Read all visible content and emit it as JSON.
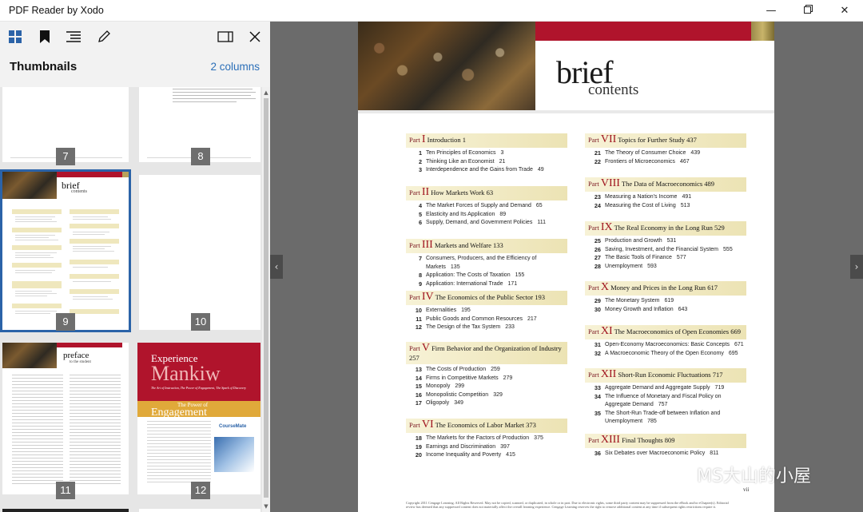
{
  "window": {
    "title": "PDF Reader by Xodo",
    "minimize": "—",
    "maximize": "❐",
    "close": "✕"
  },
  "panel": {
    "header_title": "Thumbnails",
    "columns_label": "2 columns",
    "tools": [
      "thumbnails-icon",
      "bookmark-icon",
      "outline-icon",
      "annotate-icon",
      "panel-layout-icon",
      "close-icon"
    ],
    "thumbnails": [
      {
        "page": "7"
      },
      {
        "page": "8"
      },
      {
        "page": "9",
        "title": "brief",
        "subtitle": "contents",
        "selected": true
      },
      {
        "page": "10"
      },
      {
        "page": "11",
        "title": "preface",
        "subtitle": "to the student"
      },
      {
        "page": "12",
        "title1": "Experience",
        "title2": "Mankiw",
        "tagline": "The Art of Instruction, The Power of Engagement, The Spark of Discovery",
        "title3": "The Power of",
        "title4": "Engagement",
        "brand": "CourseMate"
      }
    ]
  },
  "document": {
    "heading_big": "brief",
    "heading_small": "contents",
    "accent_red": "#b0142c",
    "parts_left": [
      {
        "word": "Part",
        "num": "I",
        "title": "Introduction",
        "page": "1",
        "chapters": [
          [
            "1",
            "Ten Principles of Economics",
            "3"
          ],
          [
            "2",
            "Thinking Like an Economist",
            "21"
          ],
          [
            "3",
            "Interdependence and the Gains from Trade",
            "49"
          ]
        ]
      },
      {
        "word": "Part",
        "num": "II",
        "title": "How Markets Work",
        "page": "63",
        "chapters": [
          [
            "4",
            "The Market Forces of Supply and Demand",
            "65"
          ],
          [
            "5",
            "Elasticity and Its Application",
            "89"
          ],
          [
            "6",
            "Supply, Demand, and Government Policies",
            "111"
          ]
        ]
      },
      {
        "word": "Part",
        "num": "III",
        "title": "Markets and Welfare",
        "page": "133",
        "chapters": [
          [
            "7",
            "Consumers, Producers, and the Efficiency of Markets",
            "135"
          ],
          [
            "8",
            "Application: The Costs of Taxation",
            "155"
          ],
          [
            "9",
            "Application: International Trade",
            "171"
          ]
        ]
      },
      {
        "word": "Part",
        "num": "IV",
        "title": "The Economics of the Public Sector",
        "page": "193",
        "chapters": [
          [
            "10",
            "Externalities",
            "195"
          ],
          [
            "11",
            "Public Goods and Common Resources",
            "217"
          ],
          [
            "12",
            "The Design of the Tax System",
            "233"
          ]
        ]
      },
      {
        "word": "Part",
        "num": "V",
        "title": "Firm Behavior and the Organization of Industry",
        "page": "257",
        "chapters": [
          [
            "13",
            "The Costs of Production",
            "259"
          ],
          [
            "14",
            "Firms in Competitive Markets",
            "279"
          ],
          [
            "15",
            "Monopoly",
            "299"
          ],
          [
            "16",
            "Monopolistic Competition",
            "329"
          ],
          [
            "17",
            "Oligopoly",
            "349"
          ]
        ]
      },
      {
        "word": "Part",
        "num": "VI",
        "title": "The Economics of Labor Market",
        "page": "373",
        "chapters": [
          [
            "18",
            "The Markets for the Factors of Production",
            "375"
          ],
          [
            "19",
            "Earnings and Discrimination",
            "397"
          ],
          [
            "20",
            "Income Inequality and Poverty",
            "415"
          ]
        ]
      }
    ],
    "parts_right": [
      {
        "word": "Part",
        "num": "VII",
        "title": "Topics for Further Study",
        "page": "437",
        "chapters": [
          [
            "21",
            "The Theory of Consumer Choice",
            "439"
          ],
          [
            "22",
            "Frontiers of Microeconomics",
            "467"
          ]
        ]
      },
      {
        "word": "Part",
        "num": "VIII",
        "title": "The Data of Macroeconomics",
        "page": "489",
        "chapters": [
          [
            "23",
            "Measuring a Nation's Income",
            "491"
          ],
          [
            "24",
            "Measuring the Cost of Living",
            "513"
          ]
        ]
      },
      {
        "word": "Part",
        "num": "IX",
        "title": "The Real Economy in the Long Run",
        "page": "529",
        "chapters": [
          [
            "25",
            "Production and Growth",
            "531"
          ],
          [
            "26",
            "Saving, Investment, and the Financial System",
            "555"
          ],
          [
            "27",
            "The Basic Tools of Finance",
            "577"
          ],
          [
            "28",
            "Unemployment",
            "593"
          ]
        ]
      },
      {
        "word": "Part",
        "num": "X",
        "title": "Money and Prices in the Long Run",
        "page": "617",
        "chapters": [
          [
            "29",
            "The Monetary System",
            "619"
          ],
          [
            "30",
            "Money Growth and Inflation",
            "643"
          ]
        ]
      },
      {
        "word": "Part",
        "num": "XI",
        "title": "The Macroeconomics of Open Economies",
        "page": "669",
        "chapters": [
          [
            "31",
            "Open-Economy Macroeconomics: Basic Concepts",
            "671"
          ],
          [
            "32",
            "A Macroeconomic Theory of the Open Economy",
            "695"
          ]
        ]
      },
      {
        "word": "Part",
        "num": "XII",
        "title": "Short-Run Economic Fluctuations",
        "page": "717",
        "chapters": [
          [
            "33",
            "Aggregate Demand and Aggregate Supply",
            "719"
          ],
          [
            "34",
            "The Influence of Monetary and Fiscal Policy on Aggregate Demand",
            "757"
          ],
          [
            "35",
            "The Short-Run Trade-off between Inflation and Unemployment",
            "785"
          ]
        ]
      },
      {
        "word": "Part",
        "num": "XIII",
        "title": "Final Thoughts",
        "page": "809",
        "chapters": [
          [
            "36",
            "Six Debates over Macroeconomic Policy",
            "811"
          ]
        ]
      }
    ],
    "copyright": "Copyright 2011 Cengage Learning. All Rights Reserved. May not be copied, scanned, or duplicated, in whole or in part. Due to electronic rights, some third party content may be suppressed from the eBook and/or eChapter(s). Editorial review has deemed that any suppressed content does not materially affect the overall learning experience. Cengage Learning reserves the right to remove additional content at any time if subsequent rights restrictions require it.",
    "page_number": "vii"
  },
  "watermark": {
    "text": "MS大山的小屋"
  },
  "nav": {
    "prev": "‹",
    "next": "›"
  }
}
